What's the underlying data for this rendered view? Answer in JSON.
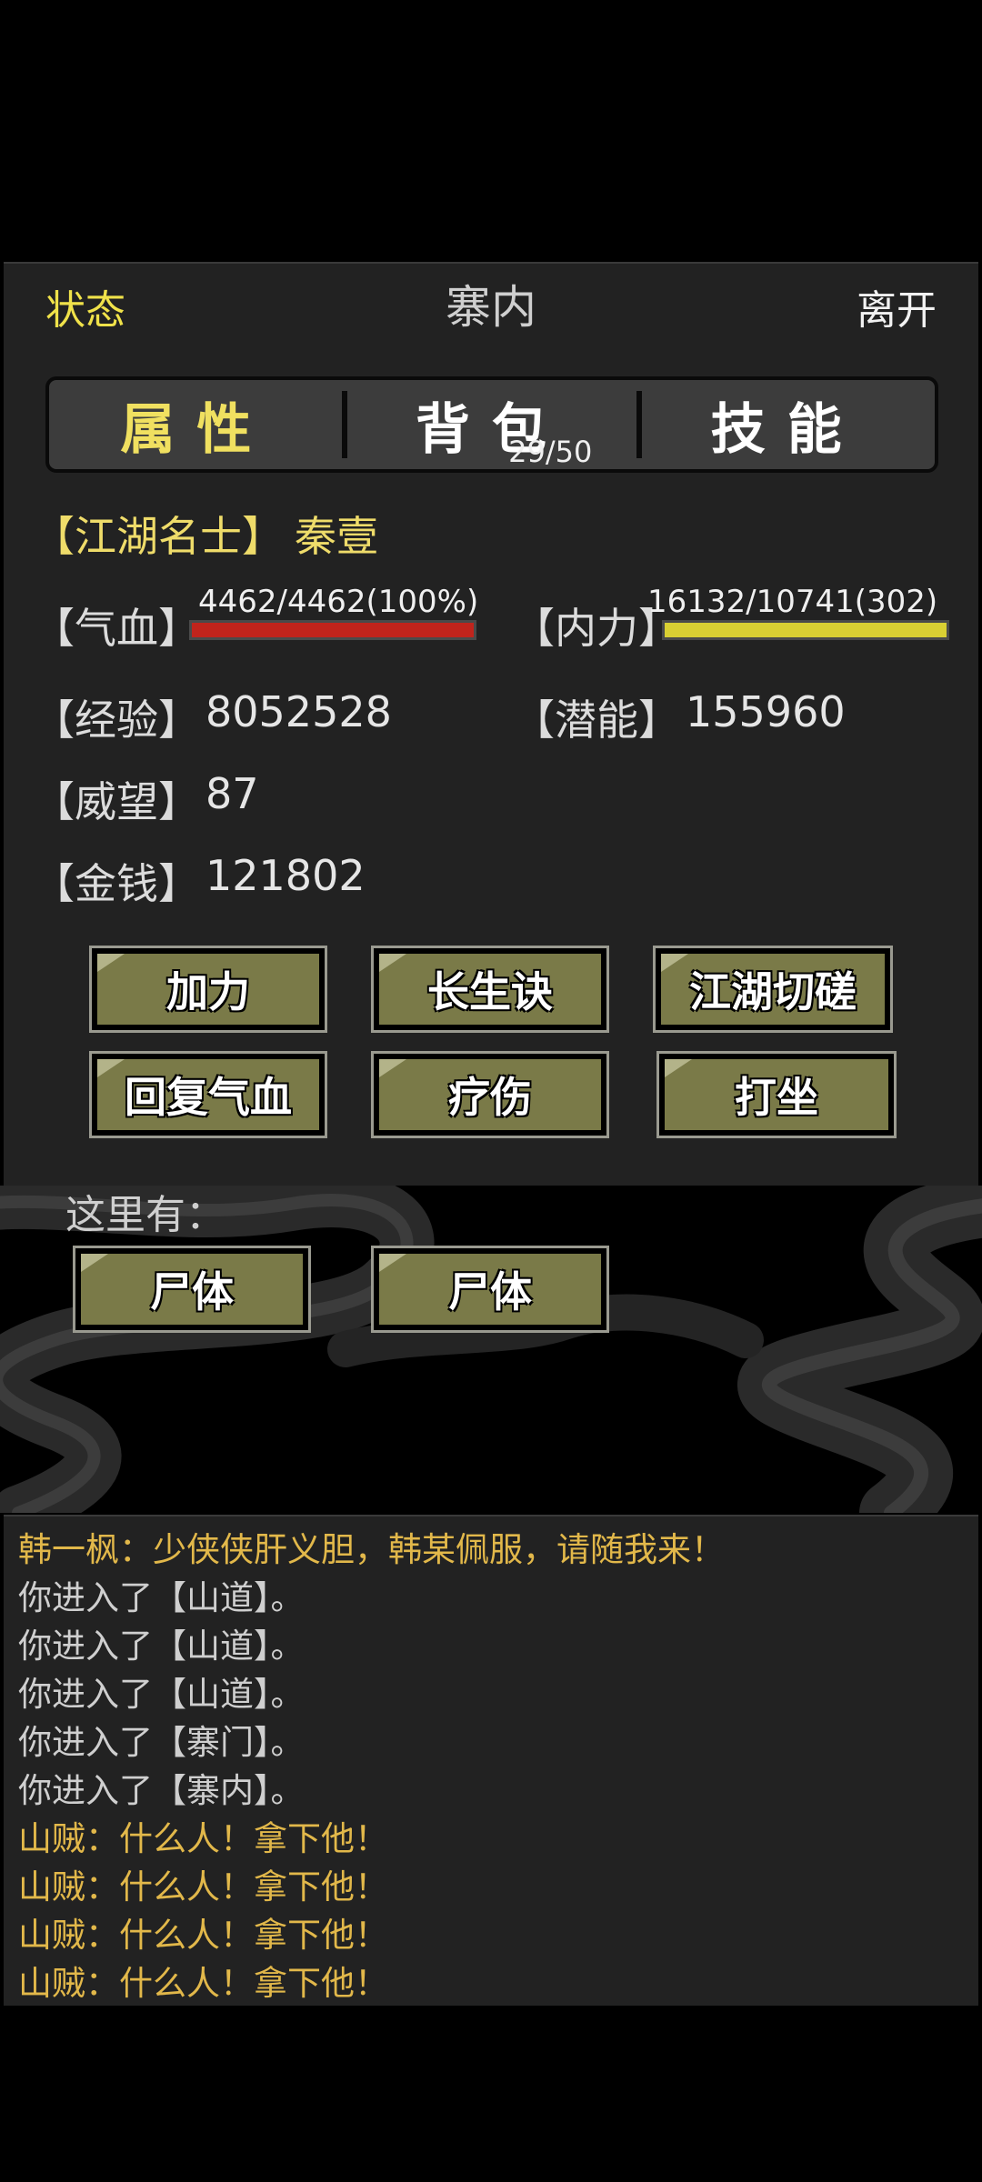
{
  "header": {
    "status": "状态",
    "title": "寨内",
    "leave": "离开"
  },
  "tabs": [
    {
      "label": "属性",
      "active": true
    },
    {
      "label": "背包",
      "count": "29/50",
      "active": false
    },
    {
      "label": "技能",
      "active": false
    }
  ],
  "character": {
    "title": "【江湖名士】",
    "name": "秦壹"
  },
  "stats": {
    "hp": {
      "label": "【气血】",
      "text": "4462/4462(100%)",
      "percent": 100,
      "color": "#c0241c"
    },
    "mp": {
      "label": "【内力】",
      "text": "16132/10741(302)",
      "percent": 100,
      "color": "#d9cf33"
    },
    "exp": {
      "label": "【经验】",
      "value": "8052528"
    },
    "potential": {
      "label": "【潜能】",
      "value": "155960"
    },
    "prestige": {
      "label": "【威望】",
      "value": "87"
    },
    "money": {
      "label": "【金钱】",
      "value": "121802"
    }
  },
  "actions": [
    "加力",
    "长生诀",
    "江湖切磋",
    "回复气血",
    "疗伤",
    "打坐"
  ],
  "here": {
    "label": "这里有：",
    "items": [
      "尸体",
      "尸体"
    ]
  },
  "log": [
    {
      "text": "韩一枫：少侠侠肝义胆，韩某佩服，请随我来！",
      "color": "#e2b84a"
    },
    {
      "text": "你进入了【山道】。",
      "color": "#cfcfcf"
    },
    {
      "text": "你进入了【山道】。",
      "color": "#cfcfcf"
    },
    {
      "text": "你进入了【山道】。",
      "color": "#cfcfcf"
    },
    {
      "text": "你进入了【寨门】。",
      "color": "#cfcfcf"
    },
    {
      "text": "你进入了【寨内】。",
      "color": "#cfcfcf"
    },
    {
      "text": "山贼：什么人！拿下他！",
      "color": "#e2b84a"
    },
    {
      "text": "山贼：什么人！拿下他！",
      "color": "#e2b84a"
    },
    {
      "text": "山贼：什么人！拿下他！",
      "color": "#e2b84a"
    },
    {
      "text": "山贼：什么人！拿下他！",
      "color": "#e2b84a"
    }
  ]
}
